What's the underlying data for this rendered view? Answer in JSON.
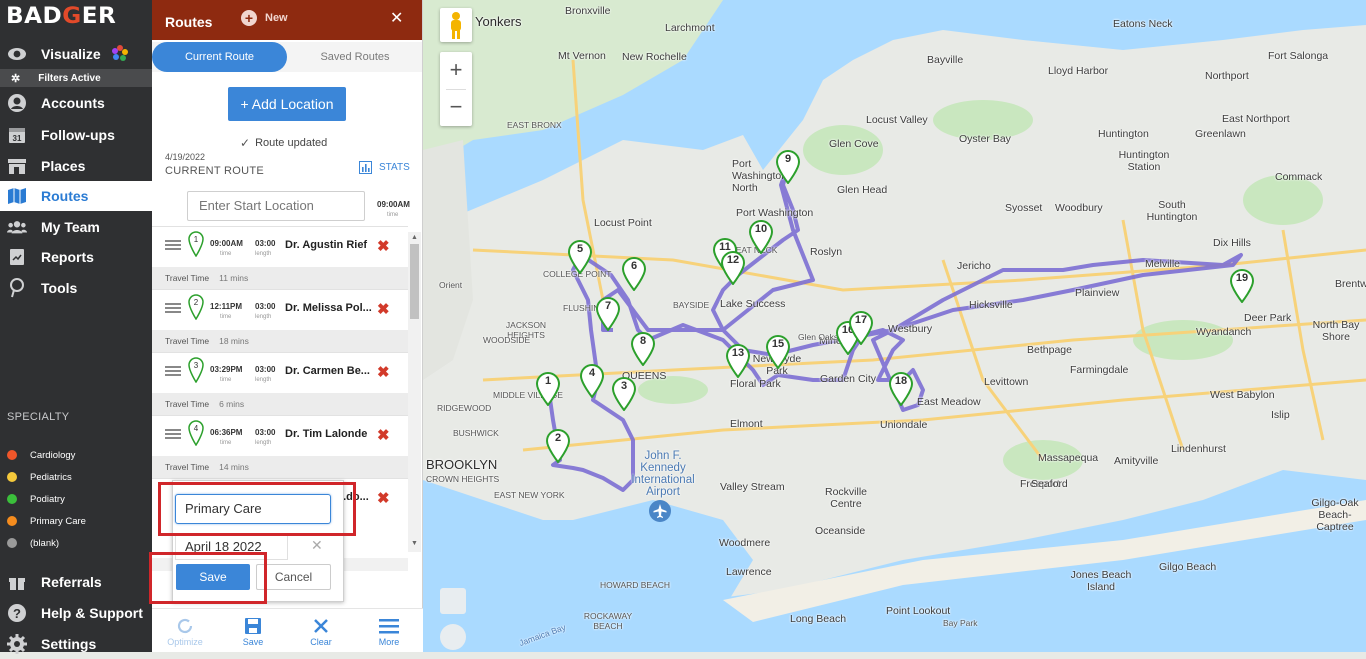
{
  "app": {
    "logo_text_left": "BAD",
    "logo_text_accent": "G",
    "logo_text_right": "ER"
  },
  "nav": {
    "items": [
      {
        "label": "Visualize",
        "icon": "eye-icon"
      },
      {
        "label": "Accounts",
        "icon": "user-circle-icon"
      },
      {
        "label": "Follow-ups",
        "icon": "calendar-icon",
        "icon_text": "31"
      },
      {
        "label": "Places",
        "icon": "store-icon"
      },
      {
        "label": "Routes",
        "icon": "map-icon",
        "active": true
      },
      {
        "label": "My Team",
        "icon": "team-icon"
      },
      {
        "label": "Reports",
        "icon": "report-icon"
      },
      {
        "label": "Tools",
        "icon": "pin-tool-icon"
      }
    ],
    "filters_active": "Filters Active",
    "specialty_title": "SPECIALTY",
    "specialties": [
      {
        "label": "Cardiology",
        "color": "#f0562a"
      },
      {
        "label": "Pediatrics",
        "color": "#f5c93b"
      },
      {
        "label": "Podiatry",
        "color": "#3bbf3b"
      },
      {
        "label": "Primary Care",
        "color": "#f58c1e"
      },
      {
        "label": "(blank)",
        "color": "#9a9a9a"
      }
    ],
    "bottom": [
      {
        "label": "Referrals",
        "icon": "gift-icon"
      },
      {
        "label": "Help & Support",
        "icon": "help-icon"
      },
      {
        "label": "Settings",
        "icon": "gear-icon"
      }
    ]
  },
  "panel": {
    "title": "Routes",
    "new_label": "New",
    "close": "✕",
    "tabs": {
      "current": "Current Route",
      "saved": "Saved Routes"
    },
    "add_location": "+ Add Location",
    "route_updated": "Route updated",
    "date": "4/19/2022",
    "current_route_label": "CURRENT ROUTE",
    "stats_label": "STATS",
    "start_placeholder": "Enter Start Location",
    "start_time": "09:00AM",
    "start_time_sub": "time",
    "stops": [
      {
        "num": "1",
        "time": "09:00AM",
        "length": "03:00",
        "name": "Dr. Agustin Rief"
      },
      {
        "num": "2",
        "time": "12:11PM",
        "length": "03:00",
        "name": "Dr. Melissa Pol..."
      },
      {
        "num": "3",
        "time": "03:29PM",
        "length": "03:00",
        "name": "Dr. Carmen Be..."
      },
      {
        "num": "4",
        "time": "06:36PM",
        "length": "03:00",
        "name": "Dr. Tim Lalonde"
      },
      {
        "num": "5",
        "time": "",
        "length": "",
        "name": "...do..."
      }
    ],
    "time_sub": "time",
    "length_sub": "length",
    "travel": [
      {
        "label": "Travel Time",
        "value": "11 mins"
      },
      {
        "label": "Travel Time",
        "value": "18 mins"
      },
      {
        "label": "Travel Time",
        "value": "6 mins"
      },
      {
        "label": "Travel Time",
        "value": "14 mins"
      }
    ],
    "save_popup": {
      "name_value": "Primary Care",
      "date_value": "April 18 2022",
      "clear": "✕",
      "save": "Save",
      "cancel": "Cancel"
    },
    "bottom_bar": [
      {
        "label": "Optimize",
        "icon": "optimize-icon",
        "disabled": true
      },
      {
        "label": "Save",
        "icon": "save-icon"
      },
      {
        "label": "Clear",
        "icon": "clear-icon"
      },
      {
        "label": "More",
        "icon": "menu-icon"
      }
    ]
  },
  "map": {
    "zoom_in": "+",
    "zoom_out": "−",
    "labels": [
      "Yonkers",
      "Bronxville",
      "Larchmont",
      "Eatons Neck",
      "Mt Vernon",
      "New Rochelle",
      "Bayville",
      "Lloyd Harbor",
      "Northport",
      "Fort Salonga",
      "EAST BRONX",
      "Locust Valley",
      "Oyster Bay",
      "Huntington",
      "Greenlawn",
      "East Northport",
      "Glen Cove",
      "Huntington Station",
      "Port Washington North",
      "Port Washington",
      "Glen Head",
      "Syosset",
      "Woodbury",
      "South Huntington",
      "Commack",
      "Locust Point",
      "Roslyn",
      "Jericho",
      "Melville",
      "Dix Hills",
      "COLLEGE POINT",
      "Lake Success",
      "Hicksville",
      "Plainview",
      "Deer Park",
      "North Bay Shore",
      "Brentwood",
      "JACKSON HEIGHTS",
      "FLUSHING",
      "Westbury",
      "Wyandanch",
      "QUEENS",
      "New Hyde Park",
      "Floral Park",
      "Mineola",
      "Garden City",
      "Bethpage",
      "Farmingdale",
      "Levittown",
      "Elmont",
      "Uniondale",
      "East Meadow",
      "West Babylon",
      "Islip",
      "BUSHWICK",
      "Lindenhurst",
      "BROOKLYN",
      "Massapequa",
      "Amityville",
      "CROWN HEIGHTS",
      "John F. Kennedy International Airport",
      "Freeport",
      "EAST NEW YORK",
      "Valley Stream",
      "Rockville Centre",
      "Seaford",
      "Gilgo-Oak Beach-Captree",
      "Oceanside",
      "Woodmere",
      "Lawrence",
      "Jones Beach Island",
      "Gilgo Beach",
      "Point Lookout",
      "Long Beach",
      "ROCKAWAY BEACH",
      "Jamaica Bay",
      "WOODSIDE",
      "MIDDLE VILLAGE",
      "RIDGEWOOD",
      "HOWARD BEACH",
      "GREAT NECK",
      "BAYSIDE",
      "Bay Park",
      "Orient",
      "Glen Oaks"
    ],
    "markers": [
      "1",
      "2",
      "3",
      "4",
      "5",
      "6",
      "7",
      "8",
      "9",
      "10",
      "11",
      "12",
      "13",
      "14",
      "15",
      "16",
      "17",
      "18",
      "19"
    ]
  }
}
